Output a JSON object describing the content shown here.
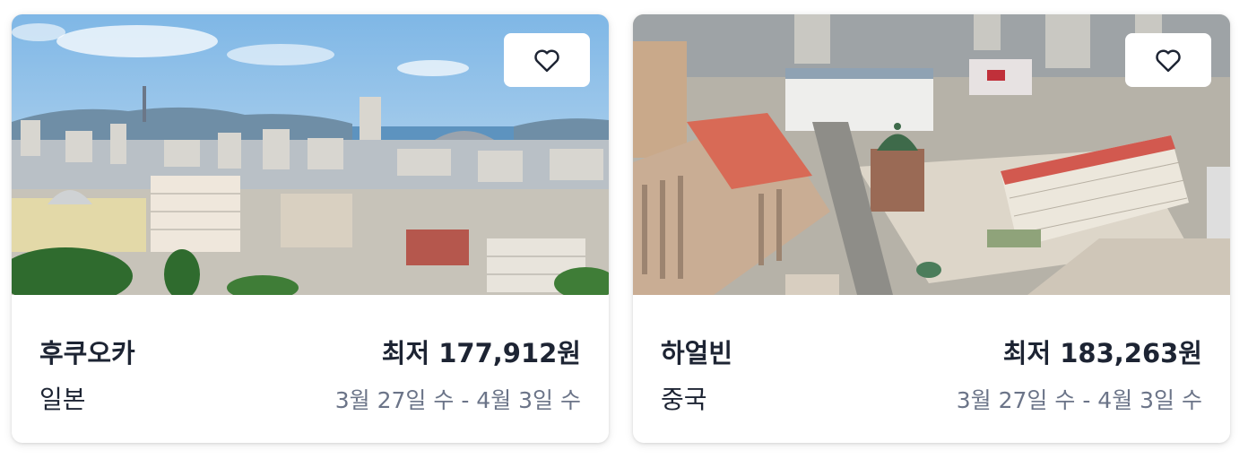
{
  "cards": [
    {
      "city": "후쿠오카",
      "country": "일본",
      "price": "최저 177,912원",
      "dates": "3월 27일 수 - 4월 3일 수",
      "favorite_icon": "heart-outline-icon"
    },
    {
      "city": "하얼빈",
      "country": "중국",
      "price": "최저 183,263원",
      "dates": "3월 27일 수 - 4월 3일 수",
      "favorite_icon": "heart-outline-icon"
    }
  ],
  "colors": {
    "text_primary": "#1d2433",
    "text_secondary": "#6b7488",
    "card_background": "#ffffff"
  }
}
